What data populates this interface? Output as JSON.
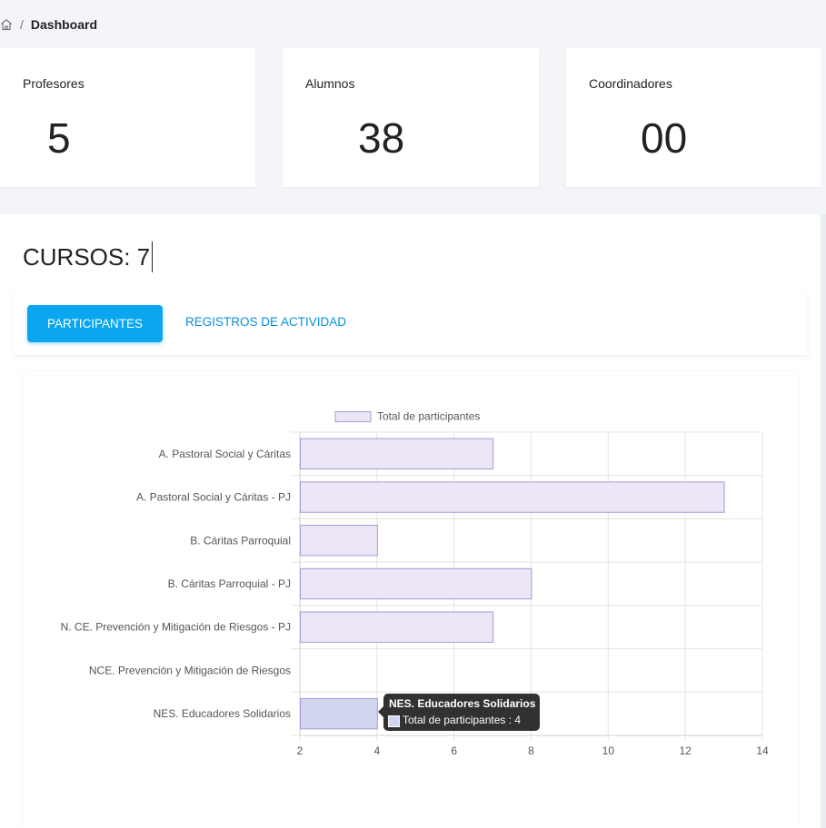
{
  "breadcrumb": {
    "separator": "/",
    "current": "Dashboard"
  },
  "stats": [
    {
      "label": "Profesores",
      "value": "5"
    },
    {
      "label": "Alumnos",
      "value": "38"
    },
    {
      "label": "Coordinadores",
      "value": "00"
    }
  ],
  "courses": {
    "title": "CURSOS: 7"
  },
  "tabs": {
    "active": "PARTICIPANTES",
    "other": "REGISTROS DE ACTIVIDAD"
  },
  "colors": {
    "accent": "#0aa6f0",
    "link": "#0a8fd8",
    "bar_fill": "#ece6f6",
    "bar_stroke": "#a39bd6",
    "bar_hover_fill": "#cfd6ee"
  },
  "chart_data": {
    "type": "bar",
    "orientation": "horizontal",
    "legend_position": "top",
    "grid": true,
    "categories": [
      "A. Pastoral Social y Cáritas",
      "A. Pastoral Social y Cáritas -  PJ",
      "B. Cáritas Parroquial",
      "B. Cáritas Parroquial - PJ",
      "N. CE. Prevención y Mitigación de Riesgos  - PJ",
      "NCE. Prevención y Mitigación de Riesgos",
      "NES. Educadores Solidarios"
    ],
    "series": [
      {
        "name": "Total de participantes",
        "values": [
          7,
          13,
          4,
          8,
          7,
          2,
          4
        ]
      }
    ],
    "xlim": [
      2,
      14
    ],
    "xticks": [
      "2",
      "4",
      "6",
      "8",
      "10",
      "12",
      "14"
    ],
    "highlighted_index": 6
  },
  "tooltip": {
    "title": "NES. Educadores Solidarios",
    "body": "Total de participantes : 4"
  }
}
